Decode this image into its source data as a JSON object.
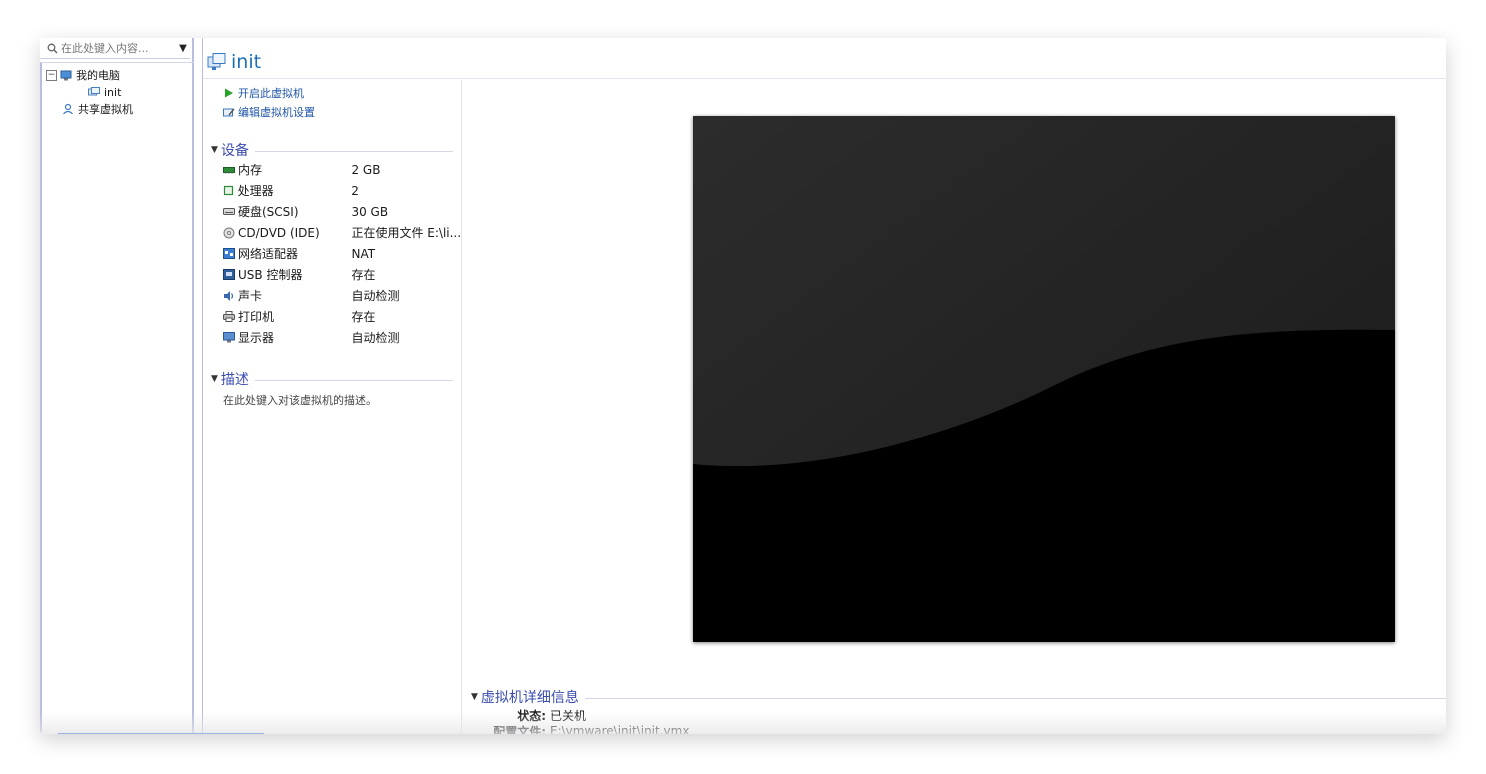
{
  "library": {
    "search_placeholder": "在此处键入内容...",
    "tree": [
      {
        "label": "我的电脑",
        "icon": "computer-icon",
        "expanded": true
      },
      {
        "label": "init",
        "icon": "vm-icon"
      },
      {
        "label": "共享虚拟机",
        "icon": "shared-vm-icon"
      }
    ]
  },
  "vm": {
    "title": "init",
    "actions": [
      {
        "label": "开启此虚拟机",
        "icon": "play-icon"
      },
      {
        "label": "编辑虚拟机设置",
        "icon": "edit-settings-icon"
      }
    ],
    "devices_header": "设备",
    "devices": [
      {
        "name": "内存",
        "value": "2 GB",
        "icon": "memory-icon"
      },
      {
        "name": "处理器",
        "value": "2",
        "icon": "processor-icon"
      },
      {
        "name": "硬盘(SCSI)",
        "value": "30 GB",
        "icon": "hard-disk-icon"
      },
      {
        "name": "CD/DVD (IDE)",
        "value": "正在使用文件 E:\\li...",
        "icon": "cd-dvd-icon"
      },
      {
        "name": "网络适配器",
        "value": "NAT",
        "icon": "network-adapter-icon"
      },
      {
        "name": "USB 控制器",
        "value": "存在",
        "icon": "usb-icon"
      },
      {
        "name": "声卡",
        "value": "自动检测",
        "icon": "sound-card-icon"
      },
      {
        "name": "打印机",
        "value": "存在",
        "icon": "printer-icon"
      },
      {
        "name": "显示器",
        "value": "自动检测",
        "icon": "display-icon"
      }
    ],
    "description_header": "描述",
    "description_placeholder": "在此处键入对该虚拟机的描述。",
    "details_header": "虚拟机详细信息",
    "details": [
      {
        "key": "状态:",
        "value": "已关机"
      },
      {
        "key": "配置文件:",
        "value": "E:\\vmware\\init\\init.vmx"
      }
    ]
  },
  "colors": {
    "accent": "#1e6fb8",
    "section_header": "#3a4cb0",
    "link": "#1f55a8",
    "preview_bg": "#1a1a1a"
  }
}
